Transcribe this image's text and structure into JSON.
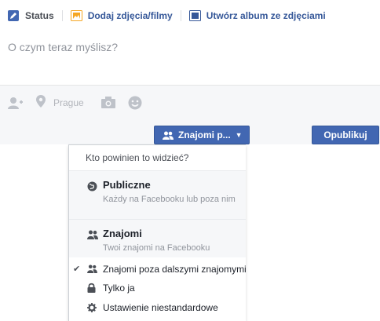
{
  "tabs": {
    "status": "Status",
    "photos": "Dodaj zdjęcia/filmy",
    "album": "Utwórz album ze zdjęciami"
  },
  "composer": {
    "placeholder": "O czym teraz myślisz?",
    "location": "Prague"
  },
  "buttons": {
    "audience": "Znajomi p...",
    "publish": "Opublikuj"
  },
  "menu": {
    "header": "Kto powinien to widzieć?",
    "items": [
      {
        "title": "Publiczne",
        "desc": "Każdy na Facebooku lub poza nim",
        "icon": "globe-icon"
      },
      {
        "title": "Znajomi",
        "desc": "Twoi znajomi na Facebooku",
        "icon": "friends-icon"
      },
      {
        "title": "Znajomi poza dalszymi znajomymi",
        "icon": "friends-icon",
        "selected": true
      },
      {
        "title": "Tylko ja",
        "icon": "lock-icon"
      },
      {
        "title": "Ustawienie niestandardowe",
        "icon": "gear-icon"
      }
    ]
  },
  "colors": {
    "brand": "#4267b2",
    "link": "#365899",
    "muted": "#90949c"
  }
}
